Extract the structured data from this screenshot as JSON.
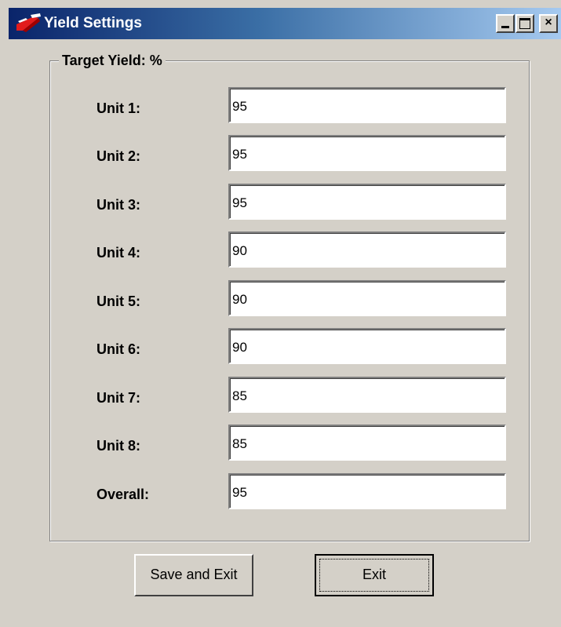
{
  "window": {
    "title": "Yield Settings",
    "icon": "app-logo-icon",
    "controls": {
      "minimize_icon": "minimize-icon",
      "maximize_icon": "maximize-icon",
      "close_glyph": "×"
    }
  },
  "group": {
    "label": "Target Yield: %"
  },
  "rows": [
    {
      "label": "Unit 1:",
      "value": "95"
    },
    {
      "label": "Unit 2:",
      "value": "95"
    },
    {
      "label": "Unit 3:",
      "value": "95"
    },
    {
      "label": "Unit 4:",
      "value": "90"
    },
    {
      "label": "Unit 5:",
      "value": "90"
    },
    {
      "label": "Unit 6:",
      "value": "90"
    },
    {
      "label": "Unit 7:",
      "value": "85"
    },
    {
      "label": "Unit 8:",
      "value": "85"
    },
    {
      "label": "Overall:",
      "value": "95"
    }
  ],
  "buttons": {
    "save_exit": "Save and Exit",
    "exit": "Exit"
  },
  "colors": {
    "title_gradient_start": "#0a246a",
    "title_gradient_end": "#a6caf0",
    "window_face": "#d4d0c8"
  }
}
